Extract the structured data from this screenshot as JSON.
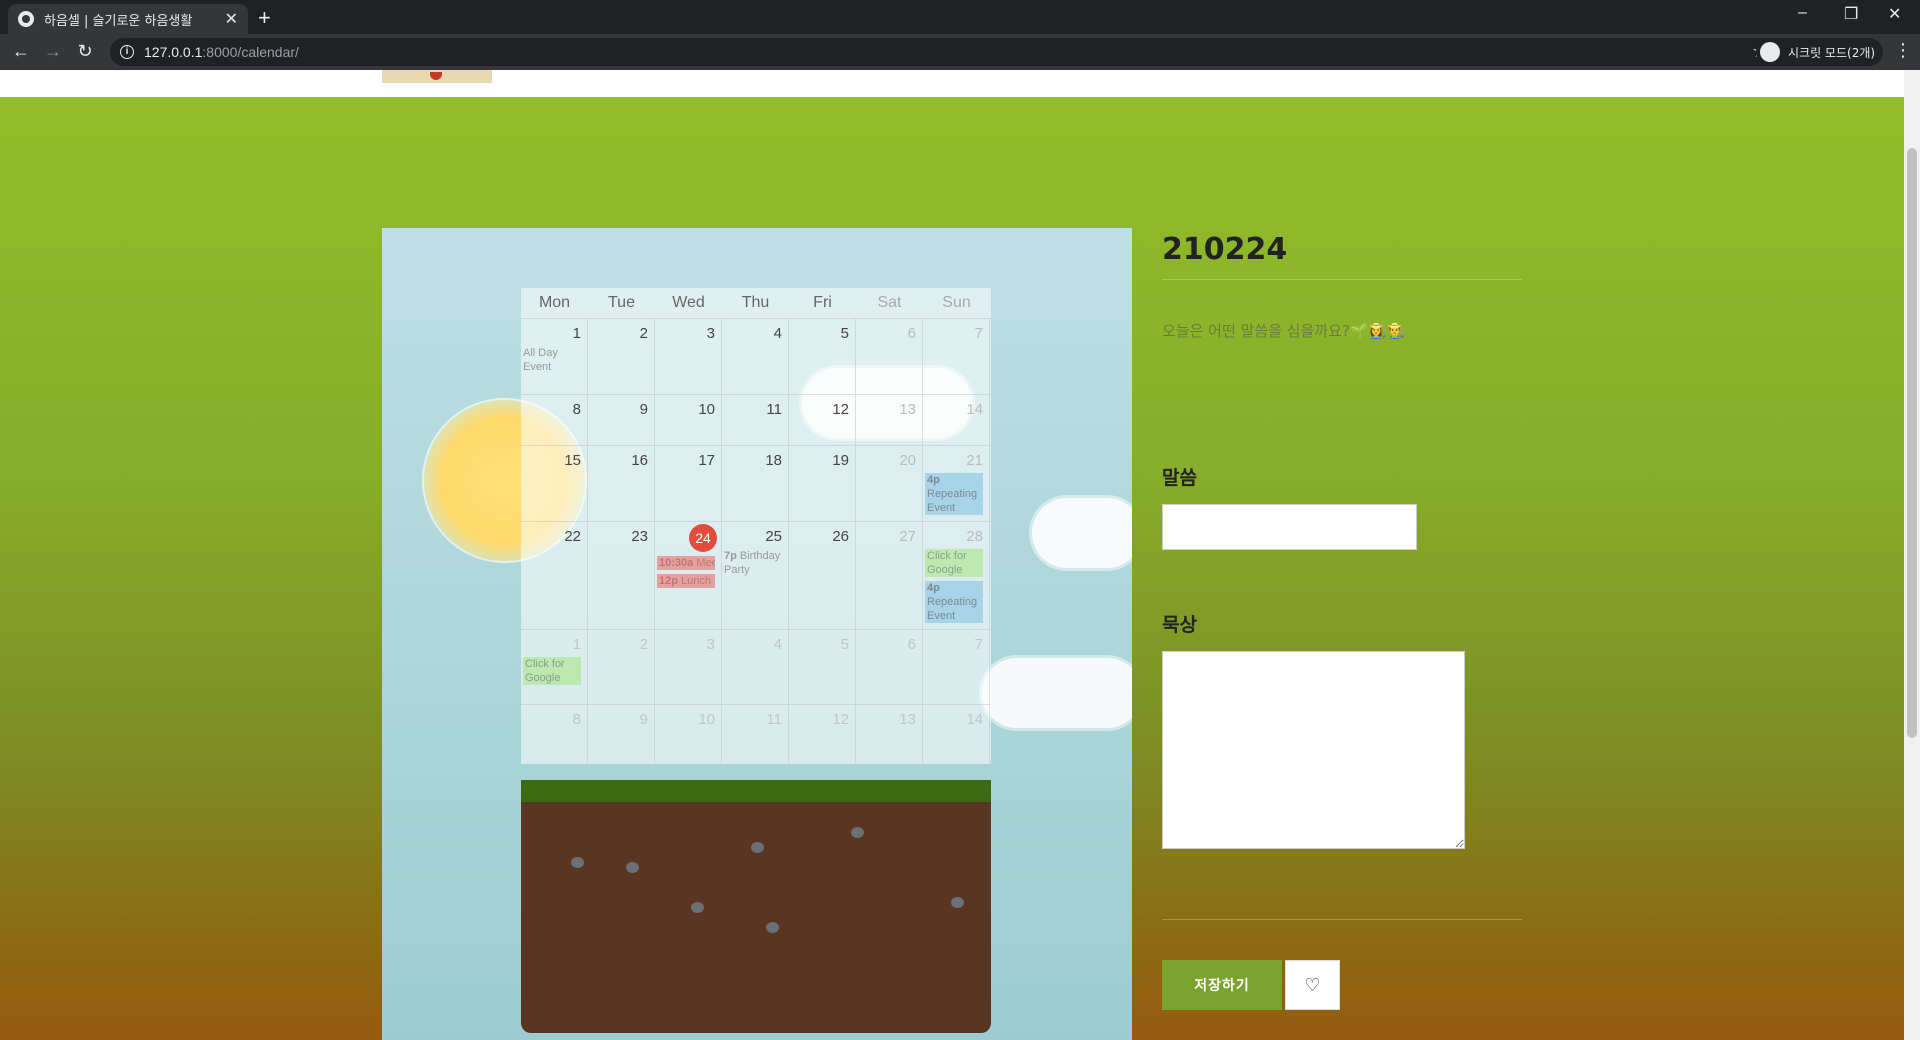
{
  "browser": {
    "tab_title": "하음셀 | 슬기로운 하음생활",
    "url_host": "127.0.0.1",
    "url_path": ":8000/calendar/",
    "incognito_label": "시크릿 모드(2개)"
  },
  "calendar": {
    "weekdays": [
      "Mon",
      "Tue",
      "Wed",
      "Thu",
      "Fri",
      "Sat",
      "Sun"
    ],
    "weeks": [
      [
        "1",
        "2",
        "3",
        "4",
        "5",
        "6",
        "7"
      ],
      [
        "8",
        "9",
        "10",
        "11",
        "12",
        "13",
        "14"
      ],
      [
        "15",
        "16",
        "17",
        "18",
        "19",
        "20",
        "21"
      ],
      [
        "22",
        "23",
        "24",
        "25",
        "26",
        "27",
        "28"
      ],
      [
        "1",
        "2",
        "3",
        "4",
        "5",
        "6",
        "7"
      ],
      [
        "8",
        "9",
        "10",
        "11",
        "12",
        "13",
        "14"
      ]
    ],
    "events": {
      "all_day": "All Day Event",
      "repeat1_time": "4p",
      "repeat1_text": "Repeating Event",
      "meeting_time": "10:30a",
      "meeting_text": "Meeting",
      "lunch_time": "12p",
      "lunch_text": "Lunch",
      "birthday_time": "7p",
      "birthday_text": "Birthday Party",
      "google1": "Click for Google",
      "repeat2_time": "4p",
      "repeat2_text": "Repeating Event",
      "google2": "Click for Google"
    }
  },
  "side": {
    "date": "210224",
    "prompt": "오늘은 어떤 말씀을 심을까요?🌱👩‍🌾👨‍🌾",
    "word_label": "말씀",
    "word_value": "",
    "meditation_label": "묵상",
    "meditation_value": "",
    "save_label": "저장하기",
    "heart_icon": "heart-icon"
  },
  "colors": {
    "accent_green": "#7aa32f",
    "today_red": "#e14c3c"
  }
}
